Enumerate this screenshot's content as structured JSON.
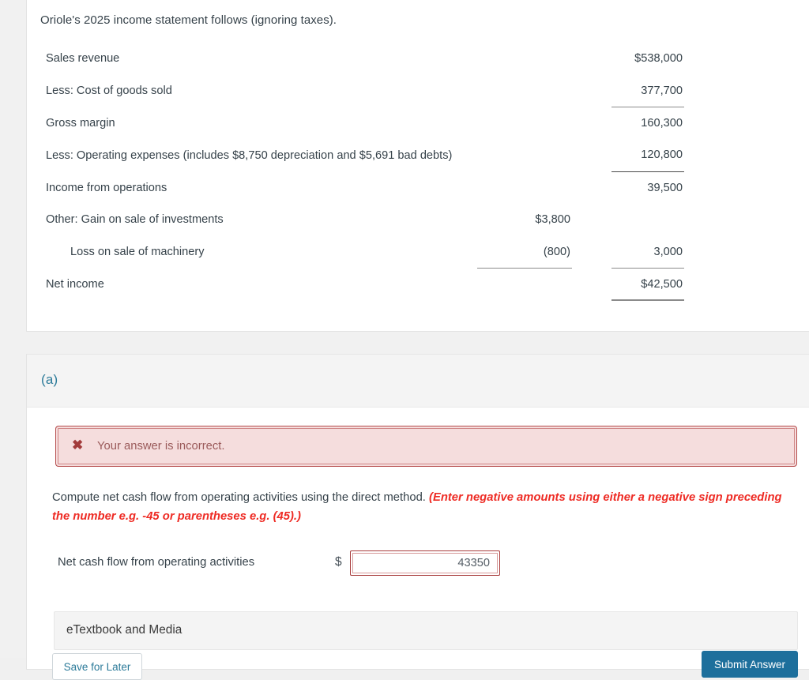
{
  "intro": {
    "text": "Oriole's 2025 income statement follows (ignoring taxes)."
  },
  "income_statement": {
    "rows": [
      {
        "label": "Sales revenue",
        "indent": false,
        "col1": "",
        "col2": "$538,000",
        "col1_rule": "none",
        "col2_rule": "none"
      },
      {
        "label": "Less: Cost of goods sold",
        "indent": false,
        "col1": "",
        "col2": "377,700",
        "col1_rule": "none",
        "col2_rule": "single"
      },
      {
        "label": "Gross margin",
        "indent": false,
        "col1": "",
        "col2": "160,300",
        "col1_rule": "none",
        "col2_rule": "none"
      },
      {
        "label": "Less: Operating expenses (includes $8,750 depreciation and $5,691 bad debts)",
        "indent": false,
        "col1": "",
        "col2": "120,800",
        "col1_rule": "none",
        "col2_rule": "strong"
      },
      {
        "label": "Income from operations",
        "indent": false,
        "col1": "",
        "col2": "39,500",
        "col1_rule": "none",
        "col2_rule": "none"
      },
      {
        "label": "Other: Gain on sale of investments",
        "indent": false,
        "col1": "$3,800",
        "col2": "",
        "col1_rule": "none",
        "col2_rule": "none"
      },
      {
        "label": "Loss on sale of machinery",
        "indent": true,
        "col1": "(800)",
        "col2": "3,000",
        "col1_rule": "single",
        "col2_rule": "single"
      },
      {
        "label": "Net income",
        "indent": false,
        "col1": "",
        "col2": "$42,500",
        "col1_rule": "none",
        "col2_rule": "double"
      }
    ]
  },
  "part_a": {
    "label": "(a)",
    "alert": {
      "icon": "cross-mark-icon",
      "text": "Your answer is incorrect."
    },
    "prompt": {
      "main": "Compute net cash flow from operating activities using the direct method.",
      "hint": "(Enter negative amounts using either a negative sign preceding the number e.g. -45 or parentheses e.g. (45).)"
    },
    "answer": {
      "label": "Net cash flow from operating activities",
      "currency_symbol": "$",
      "value": "43350",
      "placeholder": ""
    },
    "etextbook": {
      "label": "eTextbook and Media"
    },
    "buttons": {
      "secondary": "Save for Later",
      "primary": "Submit Answer"
    }
  },
  "colors": {
    "page_background": "#f1f1f1",
    "card_background": "#ffffff",
    "accent_blue": "#2b7a99",
    "primary_button": "#1d6f9c",
    "error_red": "#a83c3c",
    "hint_red": "#ee2b24",
    "alert_background": "#f5dddd",
    "text": "#36424a"
  }
}
